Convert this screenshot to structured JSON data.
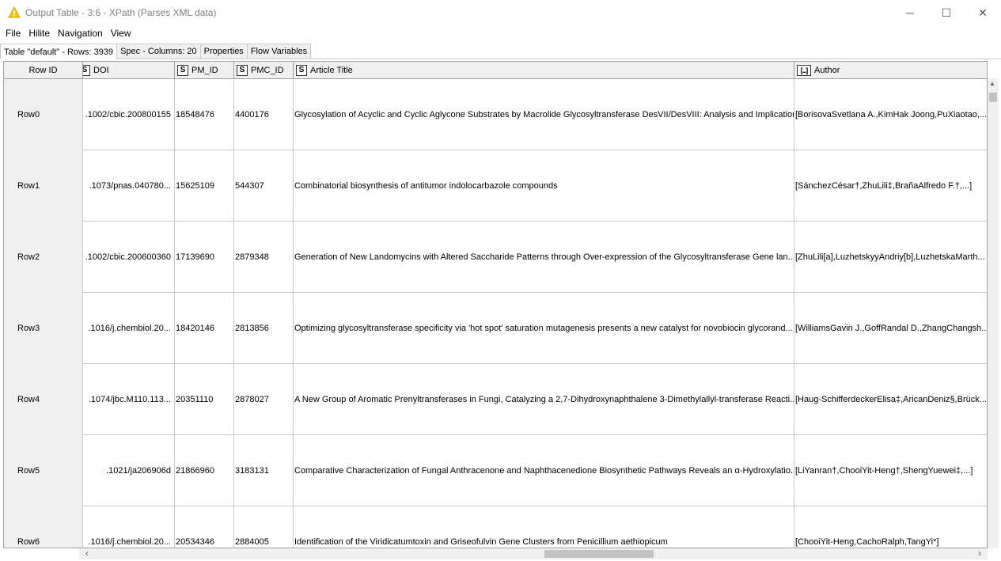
{
  "window": {
    "title": "Output Table - 3:6 - XPath (Parses XML data)",
    "minimize": "─",
    "maximize": "☐",
    "close": "✕"
  },
  "menu": [
    "File",
    "Hilite",
    "Navigation",
    "View"
  ],
  "tabs": [
    {
      "label": "Table \"default\" - Rows: 3939",
      "active": true
    },
    {
      "label": "Spec - Columns: 20",
      "active": false
    },
    {
      "label": "Properties",
      "active": false
    },
    {
      "label": "Flow Variables",
      "active": false
    }
  ],
  "columns": [
    {
      "label": "Row ID",
      "type": ""
    },
    {
      "label": "DOI",
      "type": "S"
    },
    {
      "label": "PM_ID",
      "type": "S"
    },
    {
      "label": "PMC_ID",
      "type": "S"
    },
    {
      "label": "Article Title",
      "type": "S"
    },
    {
      "label": "Author",
      "type": "[...]"
    }
  ],
  "rows": [
    {
      "id": "Row0",
      "doi": ".1002/cbic.200800155",
      "pm_id": "18548476",
      "pmc_id": "4400176",
      "title": "Glycosylation of Acyclic and Cyclic Aglycone Substrates by Macrolide Glycosyltransferase DesVII/DesVIII: Analysis and Implications",
      "author": "[BorisovaSvetlana A.,KimHak Joong,PuXiaotao,..."
    },
    {
      "id": "Row1",
      "doi": ".1073/pnas.040780...",
      "pm_id": "15625109",
      "pmc_id": "544307",
      "title": "Combinatorial biosynthesis of antitumor indolocarbazole compounds",
      "author": "[SánchezCésar†,ZhuLili‡,BrañaAlfredo F.†,...]"
    },
    {
      "id": "Row2",
      "doi": ".1002/cbic.200600360",
      "pm_id": "17139690",
      "pmc_id": "2879348",
      "title": "Generation of New Landomycins with Altered Saccharide Patterns through Over-expression of the Glycosyltransferase Gene lan...",
      "author": "[ZhuLili[a],LuzhetskyyAndriy[b],LuzhetskaMarth..."
    },
    {
      "id": "Row3",
      "doi": ".1016/j.chembiol.20...",
      "pm_id": "18420146",
      "pmc_id": "2813856",
      "title": "Optimizing glycosyltransferase specificity via 'hot spot' saturation mutagenesis presents a new catalyst for novobiocin glycorand...",
      "author": "[WilliamsGavin J.,GoffRandal D.,ZhangChangsh..."
    },
    {
      "id": "Row4",
      "doi": ".1074/jbc.M110.113...",
      "pm_id": "20351110",
      "pmc_id": "2878027",
      "title": "A New Group of Aromatic Prenyltransferases in Fungi, Catalyzing a 2,7-Dihydroxynaphthalene 3-Dimethylallyl-transferase Reacti...",
      "author": "[Haug-SchifferdeckerElisa‡,AricanDeniz§,Brück..."
    },
    {
      "id": "Row5",
      "doi": ".1021/ja206906d",
      "pm_id": "21866960",
      "pmc_id": "3183131",
      "title": "Comparative Characterization of Fungal Anthracenone and Naphthacenedione Biosynthetic Pathways Reveals an α-Hydroxylatio...",
      "author": "[LiYanran†,ChooiYit-Heng†,ShengYuewei‡,...]"
    },
    {
      "id": "Row6",
      "doi": ".1016/j.chembiol.20...",
      "pm_id": "20534346",
      "pmc_id": "2884005",
      "title": "Identification of the Viridicatumtoxin and Griseofulvin Gene Clusters from Penicillium aethiopicum",
      "author": "[ChooiYit-Heng,CachoRalph,TangYi*]"
    }
  ]
}
